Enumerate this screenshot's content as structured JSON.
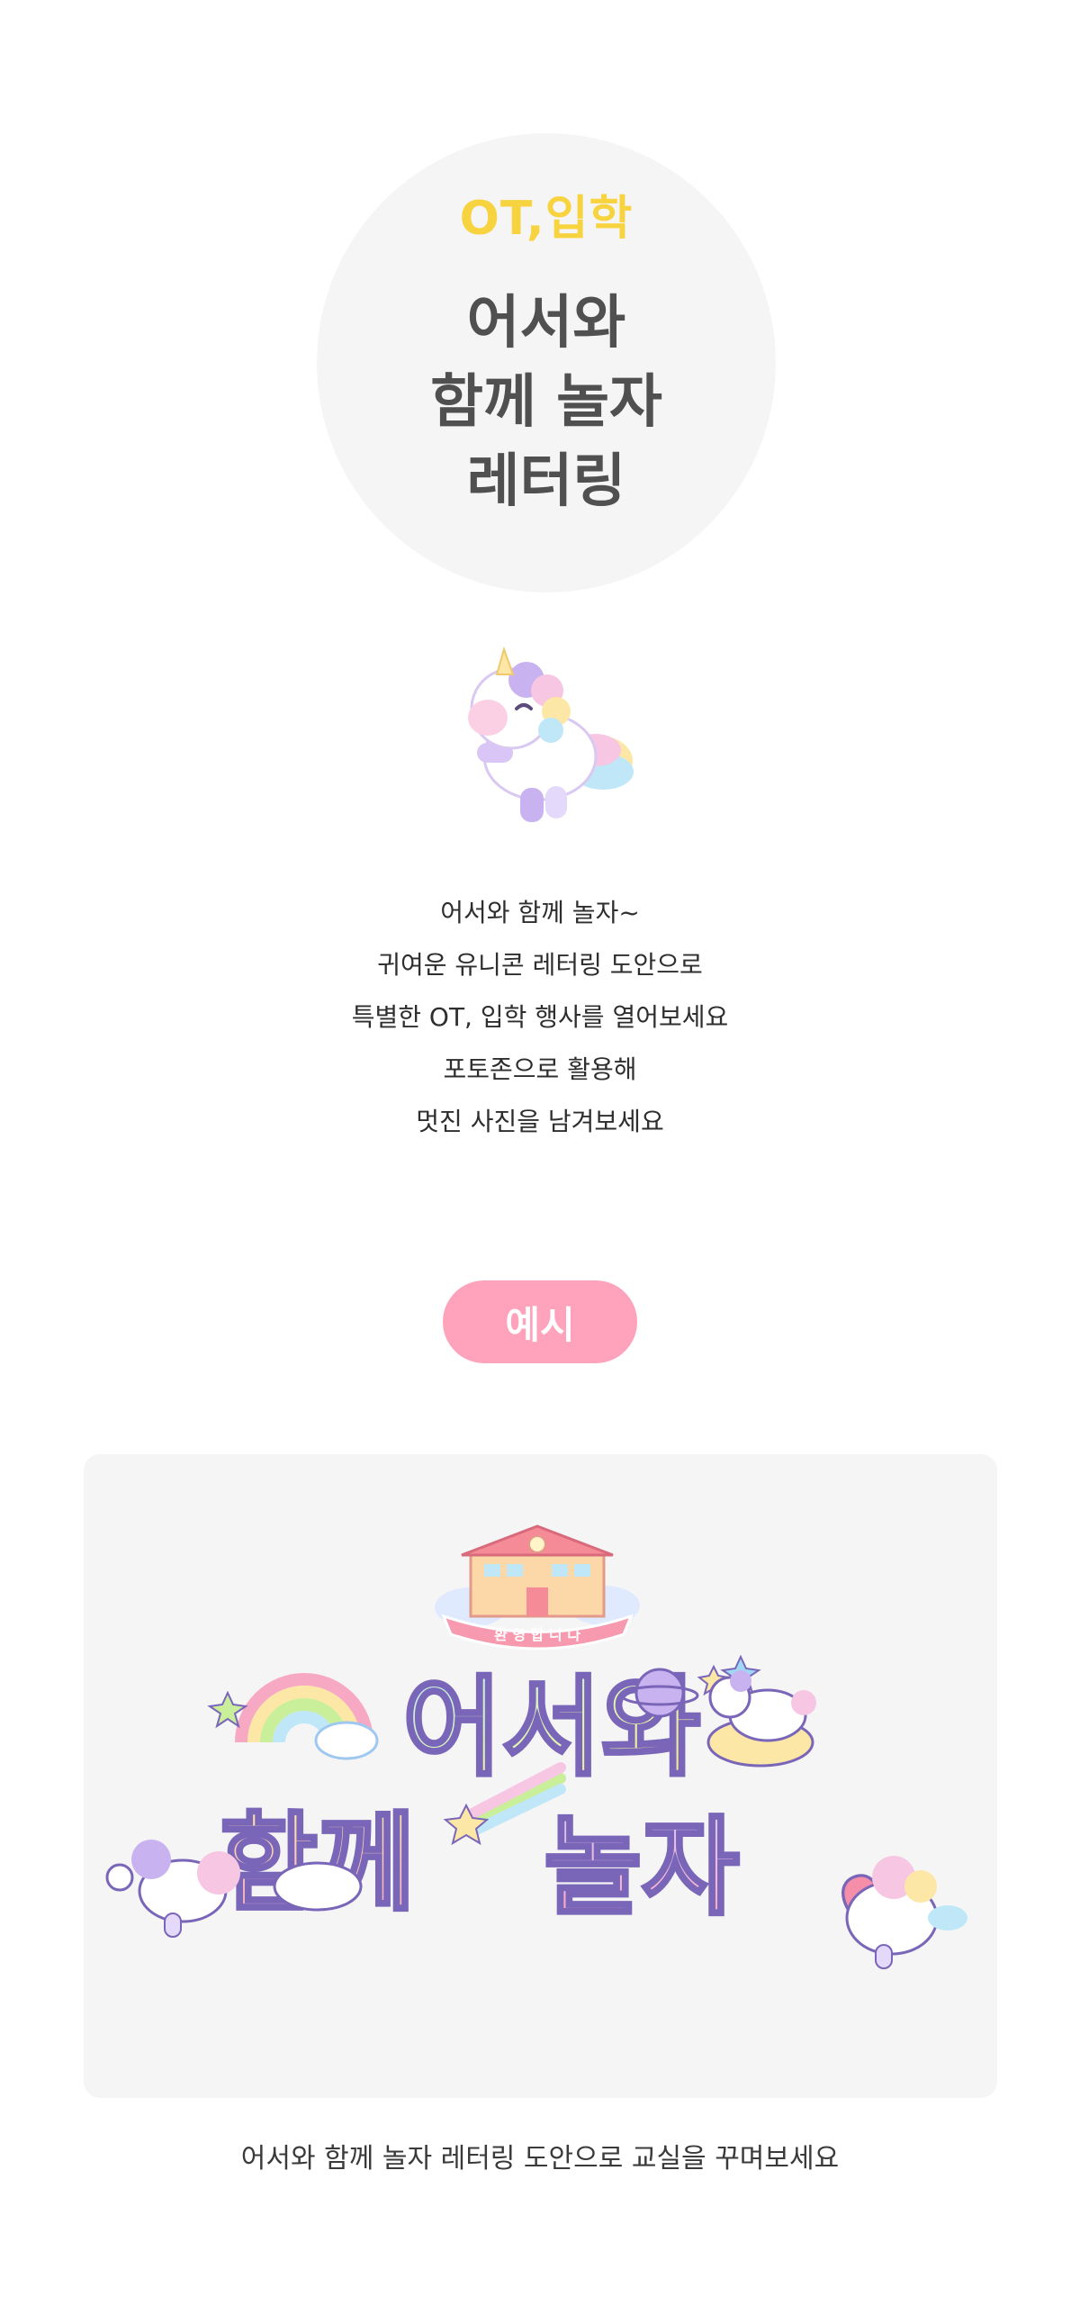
{
  "hero": {
    "category": "OT,입학",
    "title_lines": [
      "어서와",
      "함께 놀자",
      "레터링"
    ]
  },
  "description": {
    "lines": [
      "어서와 함께 놀자~",
      "귀여운 유니콘 레터링 도안으로",
      "특별한 OT, 입학 행사를 열어보세요",
      "포토존으로 활용해",
      "멋진 사진을 남겨보세요"
    ]
  },
  "example": {
    "badge_label": "예시",
    "banner": {
      "welcome_text": "환 영 합 니 다",
      "line1": "어서와",
      "line2a": "함께",
      "line2b": "놀자"
    }
  },
  "caption": "어서와 함께 놀자 레터링 도안으로 교실을 꾸며보세요",
  "colors": {
    "background": "#ffffff",
    "circle": "#f5f5f5",
    "category_yellow": "#f7d33f",
    "title_gray": "#505050",
    "badge_pink": "#ffa3bd",
    "panel": "#f5f5f5"
  },
  "icons": [
    "unicorn-icon",
    "school-icon",
    "rainbow-icon",
    "planet-icon",
    "shooting-star-icon",
    "heart-icon",
    "cloud-icon"
  ]
}
